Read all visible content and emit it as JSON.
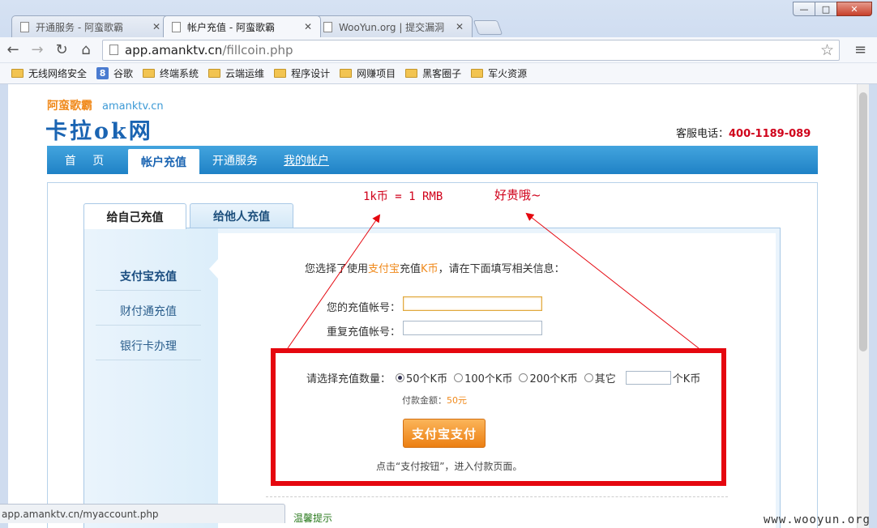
{
  "browser": {
    "window_controls": {
      "minimize": "—",
      "restore": "□",
      "close": "✕"
    },
    "tabs": [
      {
        "title": "开通服务 - 阿蛮歌霸",
        "active": false
      },
      {
        "title": "帐户充值 - 阿蛮歌霸",
        "active": true
      },
      {
        "title": "WooYun.org | 提交漏洞",
        "active": false
      }
    ],
    "address": {
      "host": "app.amanktv.cn",
      "path": "/fillcoin.php"
    },
    "bookmarks": [
      {
        "label": "无线网络安全",
        "icon": "folder-icon"
      },
      {
        "label": "谷歌",
        "icon": "google-icon"
      },
      {
        "label": "终端系统",
        "icon": "folder-icon"
      },
      {
        "label": "云端运维",
        "icon": "folder-icon"
      },
      {
        "label": "程序设计",
        "icon": "folder-icon"
      },
      {
        "label": "网赚项目",
        "icon": "folder-icon"
      },
      {
        "label": "黑客圈子",
        "icon": "folder-icon"
      },
      {
        "label": "军火资源",
        "icon": "folder-icon"
      }
    ],
    "status_url": "app.amanktv.cn/myaccount.php"
  },
  "site": {
    "brand": "阿蛮歌霸",
    "domain": "amanktv.cn",
    "logo": "卡拉ok网",
    "hotline_label": "客服电话：",
    "hotline_number": "400-1189-089",
    "nav": [
      "首 页",
      "帐户充值",
      "开通服务",
      "我的帐户"
    ]
  },
  "annotations": {
    "rate": "1k币 = 1 RMB",
    "expensive": "好贵哦~"
  },
  "recharge": {
    "tabs": [
      "给自己充值",
      "给他人充值"
    ],
    "side_menu": [
      "支付宝充值",
      "财付通充值",
      "银行卡办理"
    ],
    "intro_prefix": "您选择了使用",
    "intro_alipay": "支付宝",
    "intro_mid": "充值",
    "intro_coin": "K币",
    "intro_suffix": "，请在下面填写相关信息：",
    "account_label": "您的充值帐号：",
    "repeat_label": "重复充值帐号：",
    "amount_label": "请选择充值数量：",
    "options": [
      "50个K币",
      "100个K币",
      "200个K币",
      "其它"
    ],
    "other_unit": "个K币",
    "pay_amount_label": "付款金额：",
    "pay_amount_value": "50元",
    "pay_button": "支付宝支付",
    "pay_hint": "点击“支付按钮”，进入付款页面。",
    "warm_tip": "温馨提示"
  },
  "watermark": "www.wooyun.org",
  "colors": {
    "nav_blue": "#1f82c6",
    "annotation_red": "#e5070f",
    "accent_orange": "#ec7f12"
  }
}
